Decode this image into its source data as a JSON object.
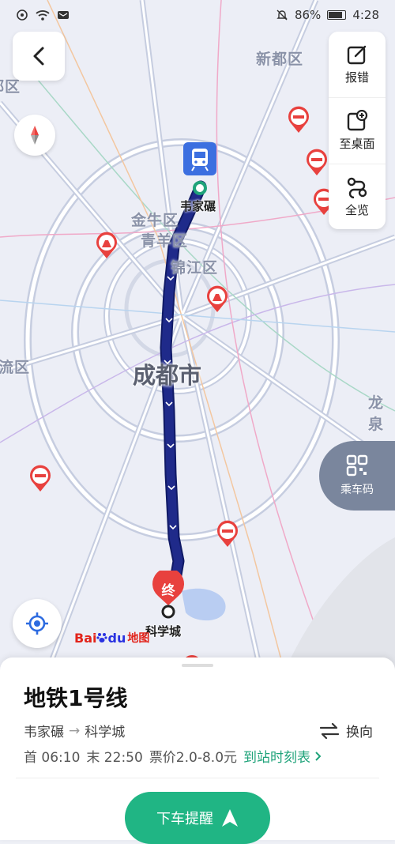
{
  "status_bar": {
    "battery": "86%",
    "time": "4:28"
  },
  "side_panel": {
    "report_label": "报错",
    "desktop_label": "至桌面",
    "overview_label": "全览"
  },
  "ride_code": {
    "label": "乘车码"
  },
  "map": {
    "districts": [
      {
        "name": "新都区"
      },
      {
        "name": "郫区"
      },
      {
        "name": "金牛区"
      },
      {
        "name": "青羊区"
      },
      {
        "name": "锦江区"
      },
      {
        "name": "流区"
      },
      {
        "name": "龙泉"
      }
    ],
    "city": "成都市",
    "start_station": "韦家碾",
    "end_station": "科学城",
    "end_marker": "终",
    "logo": {
      "part1": "Bai",
      "part2": "du",
      "part3": "地图"
    }
  },
  "sheet": {
    "line_name": "地铁1号线",
    "from": "韦家碾",
    "arrow": "→",
    "to": "科学城",
    "reverse_label": "换向",
    "first_train": "首 06:10",
    "last_train": "末 22:50",
    "fare": "票价2.0-8.0元",
    "timetable_link": "到站时刻表",
    "alight_alert": "下车提醒"
  },
  "colors": {
    "route": "#1f2a8a",
    "accent": "#20b584",
    "marker": "#e8413e"
  }
}
